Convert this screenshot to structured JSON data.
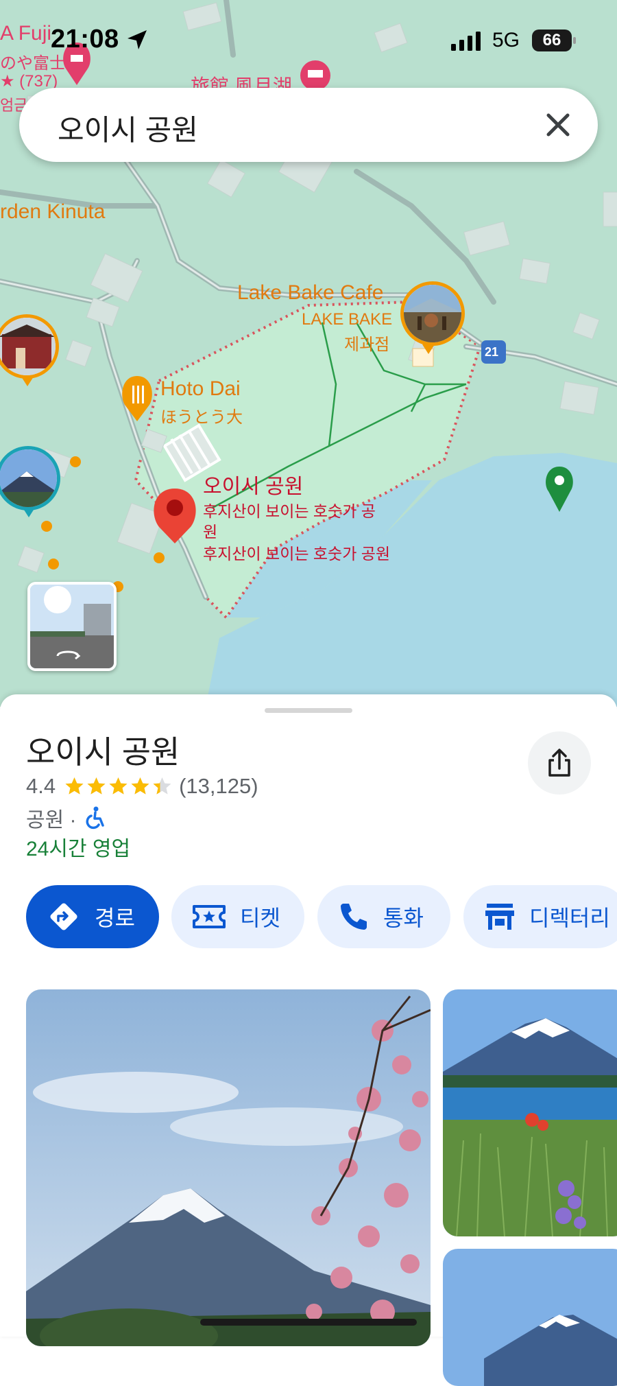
{
  "status_bar": {
    "time": "21:08",
    "network": "5G",
    "battery": "66"
  },
  "search": {
    "query": "오이시 공원"
  },
  "map_labels": {
    "hotel_name": "A Fuji",
    "hotel_sub": "のや富士",
    "hotel_reviews": "★ (737)",
    "hotel_price": "엄금",
    "ryokan": "旅館 風月湖",
    "garden": "rden Kinuta",
    "cafe_name": "Lake Bake Cafe",
    "cafe_branch_1": "LAKE BAKE",
    "cafe_branch_2": "제과점",
    "hoto_name": "Hoto Dai",
    "hoto_sub": "ほうとう大",
    "park_name": "오이시 공원",
    "park_desc_1": "후지산이 보이는 호숫가 공",
    "park_desc_2": "원",
    "park_desc_3": "후지산이 보이는 호숫가 공원",
    "route_number": "21"
  },
  "place": {
    "title": "오이시 공원",
    "rating": "4.4",
    "rating_value": 4.4,
    "reviews": "(13,125)",
    "category": "공원 ·",
    "hours": "24시간 영업"
  },
  "actions": [
    {
      "label": "경로"
    },
    {
      "label": "티켓"
    },
    {
      "label": "통화"
    },
    {
      "label": "디렉터리"
    }
  ],
  "colors": {
    "primary": "#0b57d0",
    "chip_bg": "#e8f0fe",
    "star": "#fbbc04",
    "open_green": "#188038",
    "map_pin_red": "#ea4335",
    "water": "#a8d8e6",
    "park": "#c4ecd3"
  },
  "icons": {
    "directions": "directions-icon",
    "ticket": "ticket-icon",
    "call": "phone-icon",
    "directory": "store-icon",
    "share": "share-icon",
    "accessible": "wheelchair-icon",
    "clear": "close-icon",
    "location_arrow": "location-arrow-icon"
  }
}
